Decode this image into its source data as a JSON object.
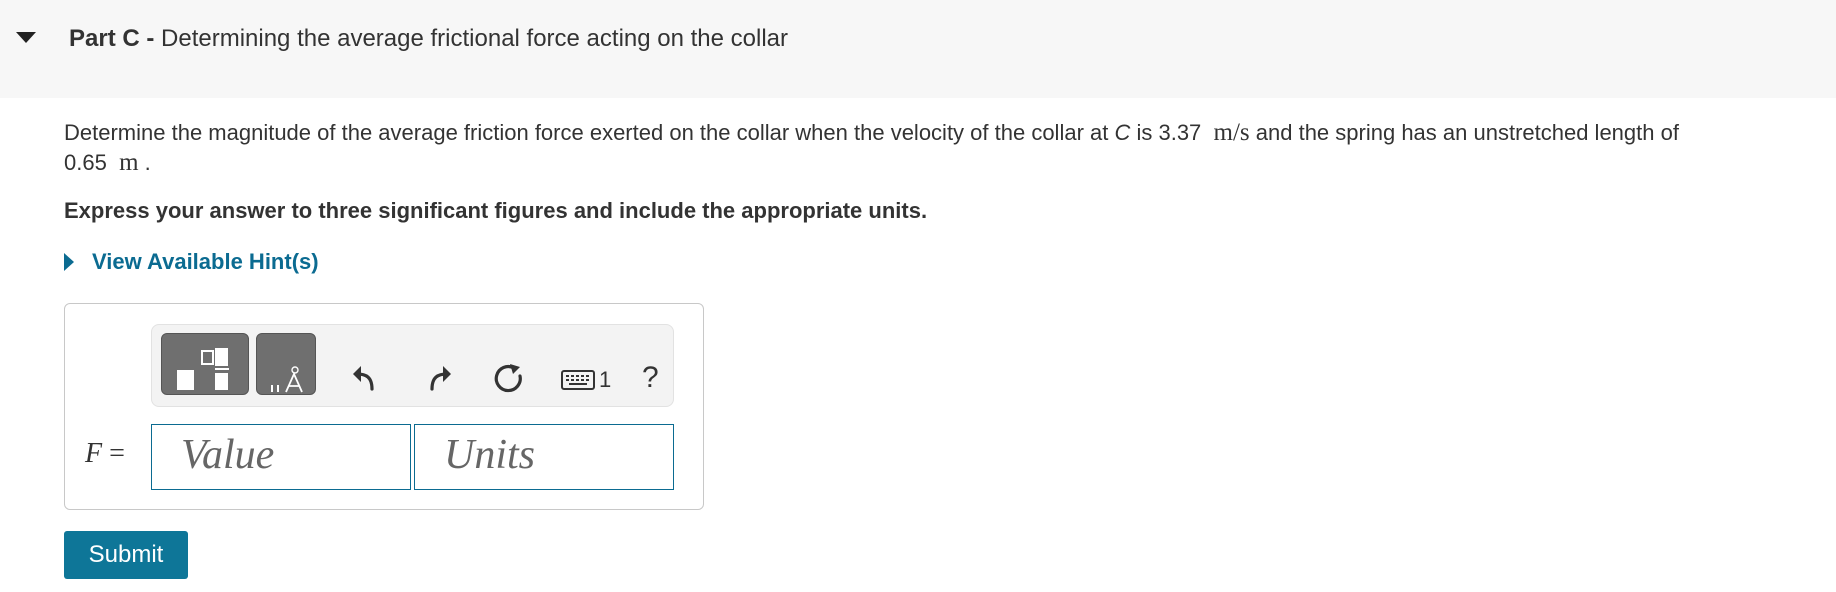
{
  "part": {
    "label": "Part C",
    "separator": " - ",
    "title": "Determining the average frictional force acting on the collar"
  },
  "question": {
    "text_1": "Determine the magnitude of the average friction force exerted on the collar when the velocity of the collar at ",
    "point": "C",
    "text_2": " is 3.37",
    "velocity_unit": "m/s",
    "text_3": " and the spring has an unstretched length of",
    "length_value": "0.65",
    "length_unit": "m",
    "period": "."
  },
  "instruction": "Express your answer to three significant figures and include the appropriate units.",
  "hint": {
    "label": "View Available Hint(s)"
  },
  "answer": {
    "variable": "F",
    "equals": "=",
    "value_placeholder": "Value",
    "units_placeholder": "Units",
    "help_glyph": "?",
    "keyboard_shortcut_suffix": "1",
    "toolbar_icons": [
      "templates-icon",
      "symbols-icon",
      "undo-icon",
      "redo-icon",
      "reset-icon",
      "keyboard-icon",
      "help-icon"
    ]
  },
  "submit": {
    "label": "Submit"
  },
  "colors": {
    "accent": "#0e7698",
    "header_bg": "#f7f7f7",
    "tool_btn": "#6f6f6f"
  }
}
